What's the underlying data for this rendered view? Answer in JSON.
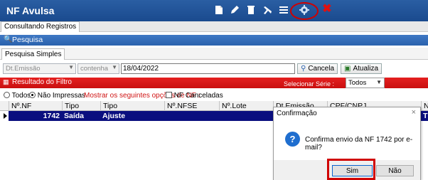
{
  "app": {
    "title": "NF Avulsa"
  },
  "toolbar": {
    "icons": [
      "new-document-icon",
      "edit-pencil-icon",
      "delete-trash-icon",
      "tools-icon",
      "menu-lines-icon",
      "send-gear-icon",
      "close-x-icon"
    ],
    "close_glyph": "✖"
  },
  "tabs": {
    "active": "Consultando Registros"
  },
  "search": {
    "section_title": "Pesquisa",
    "subtab": "Pesquisa Simples",
    "field_select": "Dt.Emissão",
    "operator_select": "contenha",
    "value": "18/04/2022",
    "cancel_label": "Cancela",
    "update_label": "Atualiza"
  },
  "results": {
    "title": "Resultado do Filtro",
    "serie_label": "Selecionar Série :",
    "serie_value": "Todos"
  },
  "filters": {
    "todos_label": "Todos",
    "nao_impressas_label": "Não Impressas",
    "mostrar_label": "Mostrar os seguintes opções de NF :",
    "canceladas_label": "NF Canceladas"
  },
  "grid": {
    "columns": [
      "Nº.NF",
      "Tipo",
      "Tipo",
      "Nº.NFSE",
      "Nº.Lote",
      "Dt.Emissão",
      "CPF/CNPJ",
      "N"
    ],
    "rows": [
      {
        "nf": "1742",
        "tipo1": "Saída",
        "tipo2": "Ajuste",
        "nfse": "",
        "lote": "",
        "last": "T"
      }
    ]
  },
  "dialog": {
    "title": "Confirmação",
    "close": "×",
    "icon": "?",
    "message": "Confirma envio da NF 1742 por e-mail?",
    "yes": "Sim",
    "no": "Não"
  },
  "colors": {
    "titlebar": "#1a4a8e",
    "section_blue": "#2a62ad",
    "result_red": "#d01515",
    "selected_row": "#0a0f7f",
    "annotation_red": "#d00000"
  }
}
